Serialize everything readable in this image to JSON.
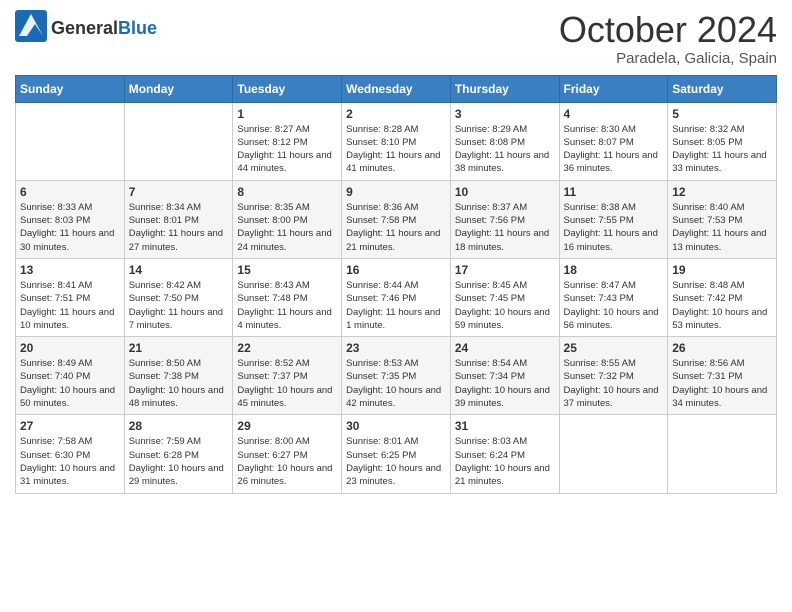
{
  "logo": {
    "general": "General",
    "blue": "Blue"
  },
  "title": "October 2024",
  "location": "Paradela, Galicia, Spain",
  "headers": [
    "Sunday",
    "Monday",
    "Tuesday",
    "Wednesday",
    "Thursday",
    "Friday",
    "Saturday"
  ],
  "weeks": [
    [
      {
        "day": "",
        "info": ""
      },
      {
        "day": "",
        "info": ""
      },
      {
        "day": "1",
        "info": "Sunrise: 8:27 AM\nSunset: 8:12 PM\nDaylight: 11 hours and 44 minutes."
      },
      {
        "day": "2",
        "info": "Sunrise: 8:28 AM\nSunset: 8:10 PM\nDaylight: 11 hours and 41 minutes."
      },
      {
        "day": "3",
        "info": "Sunrise: 8:29 AM\nSunset: 8:08 PM\nDaylight: 11 hours and 38 minutes."
      },
      {
        "day": "4",
        "info": "Sunrise: 8:30 AM\nSunset: 8:07 PM\nDaylight: 11 hours and 36 minutes."
      },
      {
        "day": "5",
        "info": "Sunrise: 8:32 AM\nSunset: 8:05 PM\nDaylight: 11 hours and 33 minutes."
      }
    ],
    [
      {
        "day": "6",
        "info": "Sunrise: 8:33 AM\nSunset: 8:03 PM\nDaylight: 11 hours and 30 minutes."
      },
      {
        "day": "7",
        "info": "Sunrise: 8:34 AM\nSunset: 8:01 PM\nDaylight: 11 hours and 27 minutes."
      },
      {
        "day": "8",
        "info": "Sunrise: 8:35 AM\nSunset: 8:00 PM\nDaylight: 11 hours and 24 minutes."
      },
      {
        "day": "9",
        "info": "Sunrise: 8:36 AM\nSunset: 7:58 PM\nDaylight: 11 hours and 21 minutes."
      },
      {
        "day": "10",
        "info": "Sunrise: 8:37 AM\nSunset: 7:56 PM\nDaylight: 11 hours and 18 minutes."
      },
      {
        "day": "11",
        "info": "Sunrise: 8:38 AM\nSunset: 7:55 PM\nDaylight: 11 hours and 16 minutes."
      },
      {
        "day": "12",
        "info": "Sunrise: 8:40 AM\nSunset: 7:53 PM\nDaylight: 11 hours and 13 minutes."
      }
    ],
    [
      {
        "day": "13",
        "info": "Sunrise: 8:41 AM\nSunset: 7:51 PM\nDaylight: 11 hours and 10 minutes."
      },
      {
        "day": "14",
        "info": "Sunrise: 8:42 AM\nSunset: 7:50 PM\nDaylight: 11 hours and 7 minutes."
      },
      {
        "day": "15",
        "info": "Sunrise: 8:43 AM\nSunset: 7:48 PM\nDaylight: 11 hours and 4 minutes."
      },
      {
        "day": "16",
        "info": "Sunrise: 8:44 AM\nSunset: 7:46 PM\nDaylight: 11 hours and 1 minute."
      },
      {
        "day": "17",
        "info": "Sunrise: 8:45 AM\nSunset: 7:45 PM\nDaylight: 10 hours and 59 minutes."
      },
      {
        "day": "18",
        "info": "Sunrise: 8:47 AM\nSunset: 7:43 PM\nDaylight: 10 hours and 56 minutes."
      },
      {
        "day": "19",
        "info": "Sunrise: 8:48 AM\nSunset: 7:42 PM\nDaylight: 10 hours and 53 minutes."
      }
    ],
    [
      {
        "day": "20",
        "info": "Sunrise: 8:49 AM\nSunset: 7:40 PM\nDaylight: 10 hours and 50 minutes."
      },
      {
        "day": "21",
        "info": "Sunrise: 8:50 AM\nSunset: 7:38 PM\nDaylight: 10 hours and 48 minutes."
      },
      {
        "day": "22",
        "info": "Sunrise: 8:52 AM\nSunset: 7:37 PM\nDaylight: 10 hours and 45 minutes."
      },
      {
        "day": "23",
        "info": "Sunrise: 8:53 AM\nSunset: 7:35 PM\nDaylight: 10 hours and 42 minutes."
      },
      {
        "day": "24",
        "info": "Sunrise: 8:54 AM\nSunset: 7:34 PM\nDaylight: 10 hours and 39 minutes."
      },
      {
        "day": "25",
        "info": "Sunrise: 8:55 AM\nSunset: 7:32 PM\nDaylight: 10 hours and 37 minutes."
      },
      {
        "day": "26",
        "info": "Sunrise: 8:56 AM\nSunset: 7:31 PM\nDaylight: 10 hours and 34 minutes."
      }
    ],
    [
      {
        "day": "27",
        "info": "Sunrise: 7:58 AM\nSunset: 6:30 PM\nDaylight: 10 hours and 31 minutes."
      },
      {
        "day": "28",
        "info": "Sunrise: 7:59 AM\nSunset: 6:28 PM\nDaylight: 10 hours and 29 minutes."
      },
      {
        "day": "29",
        "info": "Sunrise: 8:00 AM\nSunset: 6:27 PM\nDaylight: 10 hours and 26 minutes."
      },
      {
        "day": "30",
        "info": "Sunrise: 8:01 AM\nSunset: 6:25 PM\nDaylight: 10 hours and 23 minutes."
      },
      {
        "day": "31",
        "info": "Sunrise: 8:03 AM\nSunset: 6:24 PM\nDaylight: 10 hours and 21 minutes."
      },
      {
        "day": "",
        "info": ""
      },
      {
        "day": "",
        "info": ""
      }
    ]
  ]
}
